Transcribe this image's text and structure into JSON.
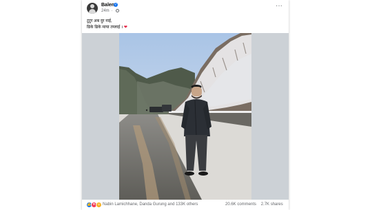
{
  "post": {
    "author": "Balen",
    "time": "24m",
    "caption_line1": "टुटुर अब दुर नाई,",
    "caption_line2": "ढिके ढिके माया तम्लाई ।"
  },
  "footer": {
    "reactors": "Nabin Lamichhane, Danda Gurung and 133K others",
    "comments": "20.6K comments",
    "shares": "2.7K shares"
  },
  "colors": {
    "like": "#1877f2",
    "love": "#f33e58",
    "care": "#f7b125"
  }
}
